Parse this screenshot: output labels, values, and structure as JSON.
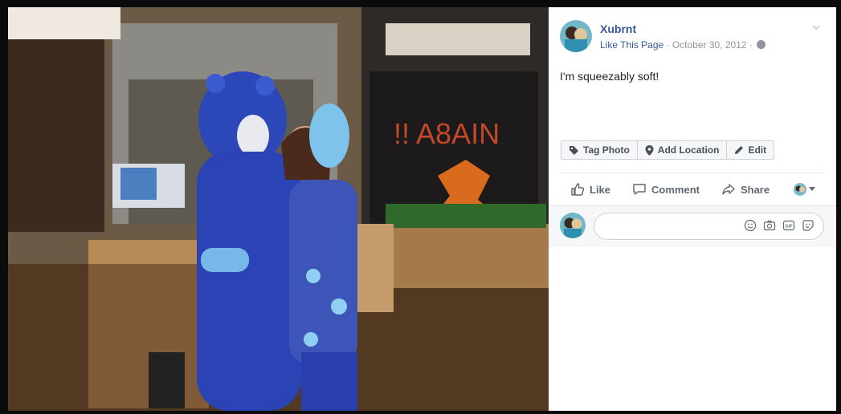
{
  "post": {
    "author": "Xubrnt",
    "like_page": "Like This Page",
    "separator": " · ",
    "date": "October 30, 2012",
    "caption": "I'm squeezably soft!"
  },
  "photo_tools": {
    "tag_photo": "Tag Photo",
    "add_location": "Add Location",
    "edit": "Edit"
  },
  "actions": {
    "like": "Like",
    "comment": "Comment",
    "share": "Share"
  },
  "comment": {
    "placeholder": ""
  },
  "icons": {
    "tag": "tag-icon",
    "location": "location-pin-icon",
    "edit": "pencil-icon",
    "like": "thumbs-up-icon",
    "comment": "speech-bubble-icon",
    "share": "share-arrow-icon",
    "emoji": "smiley-icon",
    "camera": "camera-icon",
    "gif": "gif-icon",
    "sticker": "sticker-icon",
    "privacy": "globe-icon",
    "menu": "chevron-down-icon"
  },
  "colors": {
    "link": "#365899",
    "muted": "#90949c",
    "text": "#1d2129",
    "action": "#616770"
  }
}
